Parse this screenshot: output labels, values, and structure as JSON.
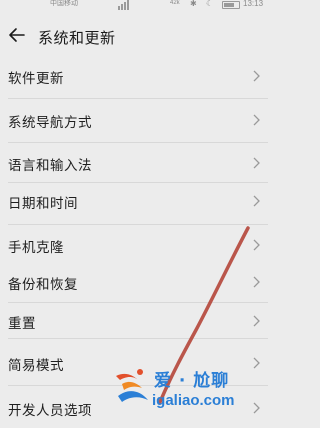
{
  "status_bar": {
    "carrier": "中国移动",
    "network_speed": "42k",
    "time": "13:13",
    "battery_level": 0.7
  },
  "header": {
    "title": "系统和更新"
  },
  "menu": {
    "items": [
      {
        "label": "软件更新"
      },
      {
        "label": "系统导航方式"
      },
      {
        "label": "语言和输入法"
      },
      {
        "label": "日期和时间"
      },
      {
        "label": "手机克隆"
      },
      {
        "label": "备份和恢复"
      },
      {
        "label": "重置"
      },
      {
        "label": "简易模式"
      },
      {
        "label": "开发人员选项"
      }
    ]
  },
  "watermark": {
    "title": "爱 · 尬聊",
    "url": "igaliao.com",
    "color": "#2b7fd6"
  },
  "colors": {
    "background": "#ececec",
    "divider": "#d8d8d8",
    "chevron": "#9a9a9a",
    "stroke": "#b5463a"
  }
}
